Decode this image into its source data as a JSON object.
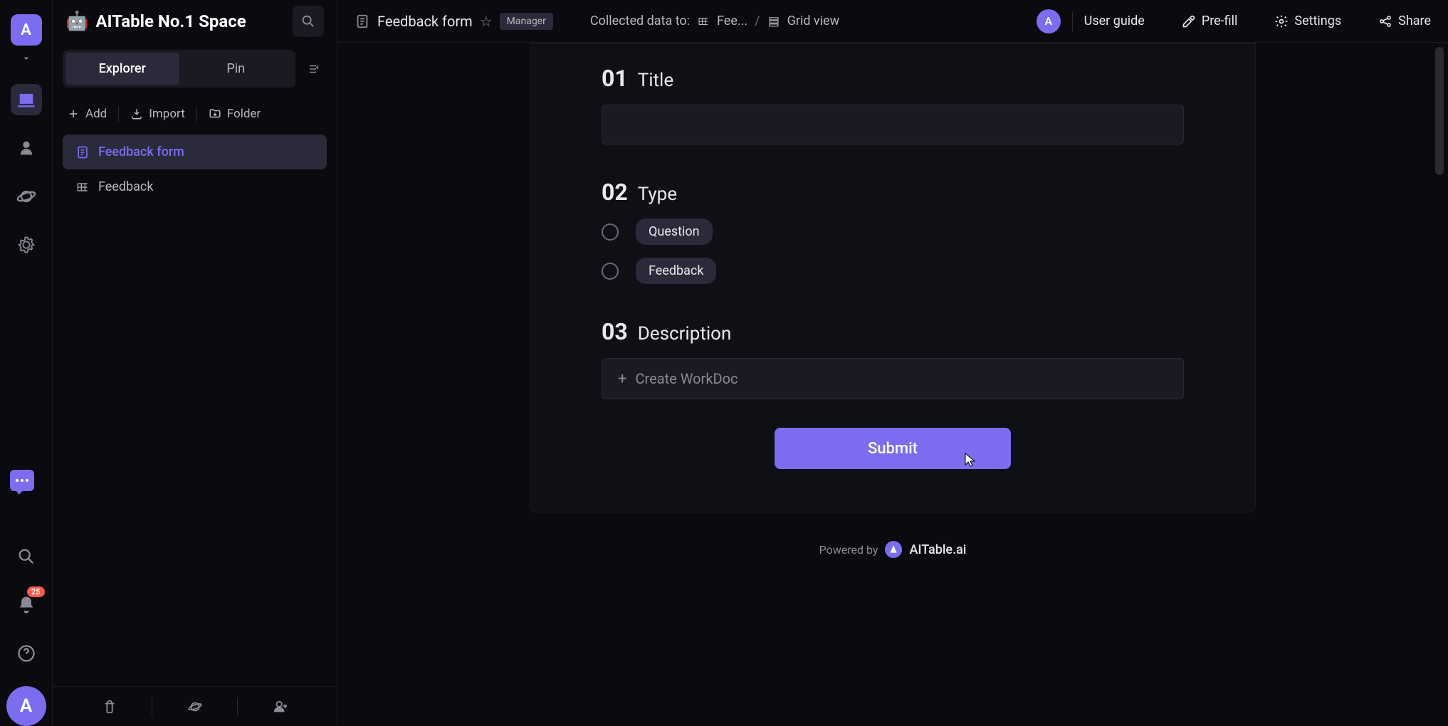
{
  "workspace": {
    "avatar_letter": "A",
    "title": "AITable No.1 Space"
  },
  "sidebar": {
    "tabs": {
      "explorer": "Explorer",
      "pin": "Pin"
    },
    "actions": {
      "add": "Add",
      "import": "Import",
      "folder": "Folder"
    },
    "tree": {
      "items": [
        {
          "label": "Feedback form",
          "active": true
        },
        {
          "label": "Feedback",
          "active": false
        }
      ]
    }
  },
  "rail": {
    "notification_count": "25",
    "bottom_avatar_letter": "A"
  },
  "header": {
    "doc_title": "Feedback form",
    "badge": "Manager",
    "collected_label": "Collected data to:",
    "breadcrumb_fee": "Fee...",
    "breadcrumb_sep": "/",
    "breadcrumb_view": "Grid view",
    "avatar_letter": "A",
    "user_guide": "User guide",
    "prefill": "Pre-fill",
    "settings": "Settings",
    "share": "Share"
  },
  "form": {
    "fields": [
      {
        "num": "01",
        "name": "Title"
      },
      {
        "num": "02",
        "name": "Type"
      },
      {
        "num": "03",
        "name": "Description"
      }
    ],
    "type_options": [
      {
        "label": "Question"
      },
      {
        "label": "Feedback"
      }
    ],
    "create_workdoc": "Create WorkDoc",
    "submit": "Submit"
  },
  "footer": {
    "powered_by": "Powered by",
    "brand": "AITable.ai"
  }
}
